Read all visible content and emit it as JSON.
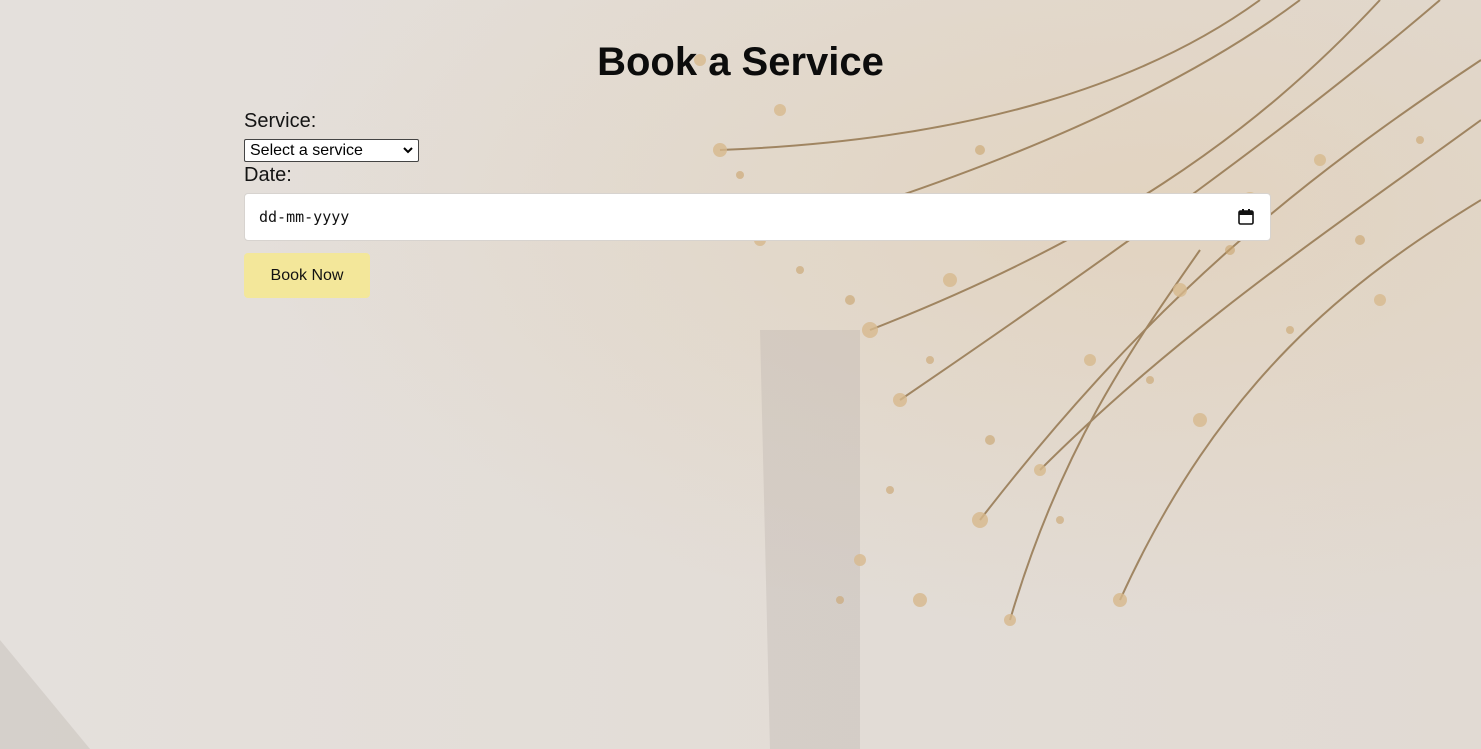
{
  "page": {
    "title": "Book a Service"
  },
  "form": {
    "service_label": "Service:",
    "service_selected": "Select a service",
    "date_label": "Date:",
    "date_placeholder": "dd-mm-yyyy",
    "submit_label": "Book Now"
  },
  "icons": {
    "select": "chevron-down-icon",
    "date": "calendar-icon"
  },
  "colors": {
    "background": "#e6e1dc",
    "button": "#f3e79a",
    "field": "#ffffff"
  }
}
